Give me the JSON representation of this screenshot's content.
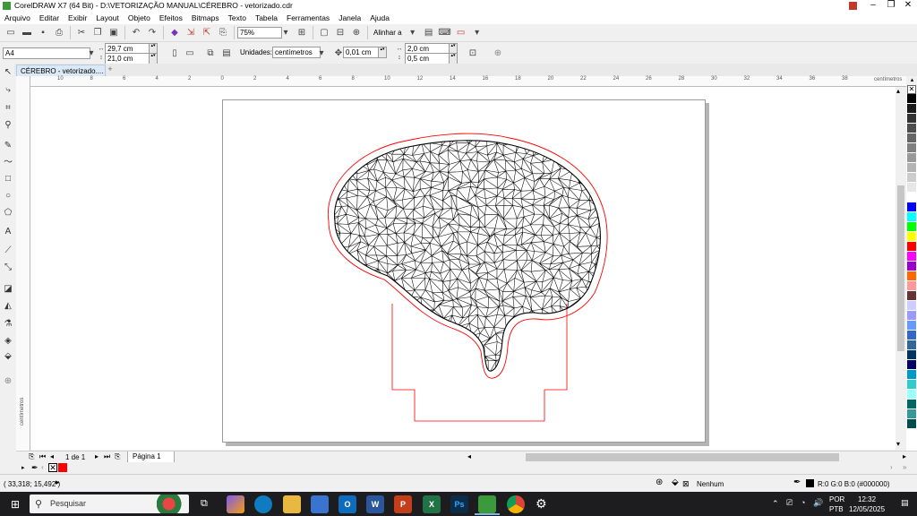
{
  "window": {
    "title": "CorelDRAW X7 (64 Bit) - D:\\VETORIZAÇÃO MANUAL\\CÉREBRO - vetorizado.cdr",
    "controls": [
      "–",
      "❐",
      "✕"
    ]
  },
  "menu": [
    "Arquivo",
    "Editar",
    "Exibir",
    "Layout",
    "Objeto",
    "Efeitos",
    "Bitmaps",
    "Texto",
    "Tabela",
    "Ferramentas",
    "Janela",
    "Ajuda"
  ],
  "toolbar": {
    "zoom": "75%",
    "align_label": "Alinhar a"
  },
  "propbar": {
    "page_size": "A4",
    "width": "29,7 cm",
    "height": "21,0 cm",
    "units_label": "Unidades:",
    "units": "centímetros",
    "nudge": "0,01 cm",
    "dup_x": "2,0 cm",
    "dup_y": "0,5 cm"
  },
  "document_tab": "CÉREBRO - vetorizado....",
  "ruler": {
    "h_labels": [
      "10",
      "8",
      "6",
      "4",
      "2",
      "0",
      "2",
      "4",
      "6",
      "8",
      "10",
      "12",
      "14",
      "16",
      "18",
      "20",
      "22",
      "24",
      "26",
      "28",
      "30",
      "32",
      "34",
      "36",
      "38"
    ],
    "units_text": "centímetros",
    "v_units_text": "centímetros"
  },
  "pagebar": {
    "page_count": "1 de 1",
    "page_tab": "Página 1"
  },
  "status": {
    "coords": "( 33,318; 15,492 )",
    "fill": "Nenhum",
    "outline": "R:0 G:0 B:0 (#000000)"
  },
  "taskbar": {
    "search_placeholder": "Pesquisar",
    "lang1": "POR",
    "lang2": "PTB",
    "time": "12:32",
    "date": "12/05/2025"
  },
  "palette": [
    "#000000",
    "#1a1a1a",
    "#333333",
    "#4d4d4d",
    "#666666",
    "#808080",
    "#999999",
    "#b3b3b3",
    "#cccccc",
    "#e6e6e6",
    "#ffffff",
    "#0000ff",
    "#00ffff",
    "#00ff00",
    "#ffff00",
    "#ff0000",
    "#ff00ff",
    "#9900cc",
    "#ff6600",
    "#ff9999",
    "#663333",
    "#ccccff",
    "#9999ff",
    "#6699ff",
    "#3366cc",
    "#336699",
    "#003366",
    "#000066",
    "#0099cc",
    "#33cccc",
    "#99ffff",
    "#006666",
    "#339999",
    "#004d4d"
  ],
  "colors": {
    "cut_line": "#ff0000",
    "accent": "#2a6fbf"
  }
}
